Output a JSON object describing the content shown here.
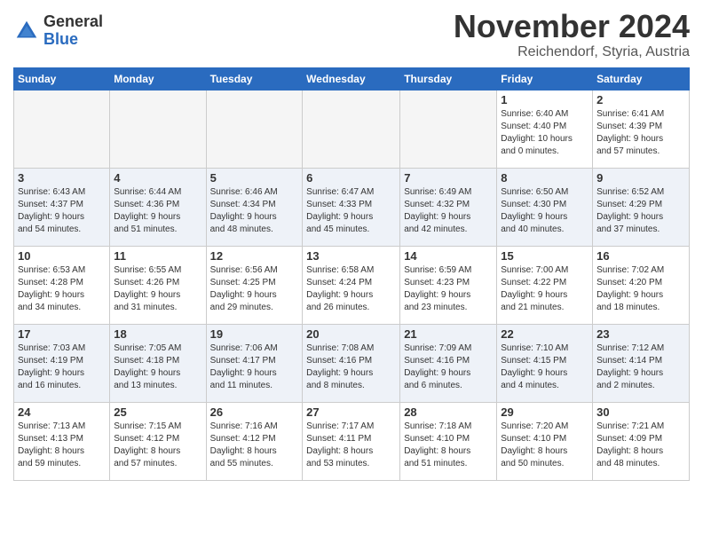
{
  "header": {
    "logo_general": "General",
    "logo_blue": "Blue",
    "month_title": "November 2024",
    "location": "Reichendorf, Styria, Austria"
  },
  "calendar": {
    "days_of_week": [
      "Sunday",
      "Monday",
      "Tuesday",
      "Wednesday",
      "Thursday",
      "Friday",
      "Saturday"
    ],
    "weeks": [
      [
        {
          "day": "",
          "info": ""
        },
        {
          "day": "",
          "info": ""
        },
        {
          "day": "",
          "info": ""
        },
        {
          "day": "",
          "info": ""
        },
        {
          "day": "",
          "info": ""
        },
        {
          "day": "1",
          "info": "Sunrise: 6:40 AM\nSunset: 4:40 PM\nDaylight: 10 hours\nand 0 minutes."
        },
        {
          "day": "2",
          "info": "Sunrise: 6:41 AM\nSunset: 4:39 PM\nDaylight: 9 hours\nand 57 minutes."
        }
      ],
      [
        {
          "day": "3",
          "info": "Sunrise: 6:43 AM\nSunset: 4:37 PM\nDaylight: 9 hours\nand 54 minutes."
        },
        {
          "day": "4",
          "info": "Sunrise: 6:44 AM\nSunset: 4:36 PM\nDaylight: 9 hours\nand 51 minutes."
        },
        {
          "day": "5",
          "info": "Sunrise: 6:46 AM\nSunset: 4:34 PM\nDaylight: 9 hours\nand 48 minutes."
        },
        {
          "day": "6",
          "info": "Sunrise: 6:47 AM\nSunset: 4:33 PM\nDaylight: 9 hours\nand 45 minutes."
        },
        {
          "day": "7",
          "info": "Sunrise: 6:49 AM\nSunset: 4:32 PM\nDaylight: 9 hours\nand 42 minutes."
        },
        {
          "day": "8",
          "info": "Sunrise: 6:50 AM\nSunset: 4:30 PM\nDaylight: 9 hours\nand 40 minutes."
        },
        {
          "day": "9",
          "info": "Sunrise: 6:52 AM\nSunset: 4:29 PM\nDaylight: 9 hours\nand 37 minutes."
        }
      ],
      [
        {
          "day": "10",
          "info": "Sunrise: 6:53 AM\nSunset: 4:28 PM\nDaylight: 9 hours\nand 34 minutes."
        },
        {
          "day": "11",
          "info": "Sunrise: 6:55 AM\nSunset: 4:26 PM\nDaylight: 9 hours\nand 31 minutes."
        },
        {
          "day": "12",
          "info": "Sunrise: 6:56 AM\nSunset: 4:25 PM\nDaylight: 9 hours\nand 29 minutes."
        },
        {
          "day": "13",
          "info": "Sunrise: 6:58 AM\nSunset: 4:24 PM\nDaylight: 9 hours\nand 26 minutes."
        },
        {
          "day": "14",
          "info": "Sunrise: 6:59 AM\nSunset: 4:23 PM\nDaylight: 9 hours\nand 23 minutes."
        },
        {
          "day": "15",
          "info": "Sunrise: 7:00 AM\nSunset: 4:22 PM\nDaylight: 9 hours\nand 21 minutes."
        },
        {
          "day": "16",
          "info": "Sunrise: 7:02 AM\nSunset: 4:20 PM\nDaylight: 9 hours\nand 18 minutes."
        }
      ],
      [
        {
          "day": "17",
          "info": "Sunrise: 7:03 AM\nSunset: 4:19 PM\nDaylight: 9 hours\nand 16 minutes."
        },
        {
          "day": "18",
          "info": "Sunrise: 7:05 AM\nSunset: 4:18 PM\nDaylight: 9 hours\nand 13 minutes."
        },
        {
          "day": "19",
          "info": "Sunrise: 7:06 AM\nSunset: 4:17 PM\nDaylight: 9 hours\nand 11 minutes."
        },
        {
          "day": "20",
          "info": "Sunrise: 7:08 AM\nSunset: 4:16 PM\nDaylight: 9 hours\nand 8 minutes."
        },
        {
          "day": "21",
          "info": "Sunrise: 7:09 AM\nSunset: 4:16 PM\nDaylight: 9 hours\nand 6 minutes."
        },
        {
          "day": "22",
          "info": "Sunrise: 7:10 AM\nSunset: 4:15 PM\nDaylight: 9 hours\nand 4 minutes."
        },
        {
          "day": "23",
          "info": "Sunrise: 7:12 AM\nSunset: 4:14 PM\nDaylight: 9 hours\nand 2 minutes."
        }
      ],
      [
        {
          "day": "24",
          "info": "Sunrise: 7:13 AM\nSunset: 4:13 PM\nDaylight: 8 hours\nand 59 minutes."
        },
        {
          "day": "25",
          "info": "Sunrise: 7:15 AM\nSunset: 4:12 PM\nDaylight: 8 hours\nand 57 minutes."
        },
        {
          "day": "26",
          "info": "Sunrise: 7:16 AM\nSunset: 4:12 PM\nDaylight: 8 hours\nand 55 minutes."
        },
        {
          "day": "27",
          "info": "Sunrise: 7:17 AM\nSunset: 4:11 PM\nDaylight: 8 hours\nand 53 minutes."
        },
        {
          "day": "28",
          "info": "Sunrise: 7:18 AM\nSunset: 4:10 PM\nDaylight: 8 hours\nand 51 minutes."
        },
        {
          "day": "29",
          "info": "Sunrise: 7:20 AM\nSunset: 4:10 PM\nDaylight: 8 hours\nand 50 minutes."
        },
        {
          "day": "30",
          "info": "Sunrise: 7:21 AM\nSunset: 4:09 PM\nDaylight: 8 hours\nand 48 minutes."
        }
      ]
    ]
  }
}
